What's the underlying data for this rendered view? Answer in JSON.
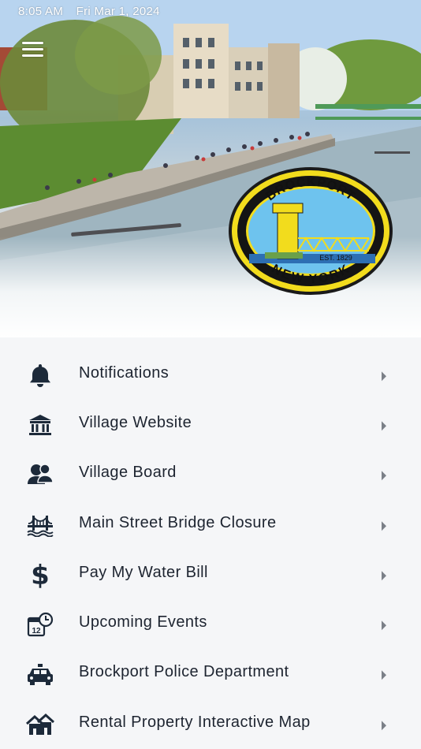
{
  "status_bar": {
    "time": "8:05 AM",
    "date": "Fri Mar 1, 2024"
  },
  "header": {
    "menu_icon": "hamburger-menu-icon"
  },
  "seal": {
    "top_text": "BROCKPORT",
    "bottom_text": "NEW YORK",
    "est": "EST. 1829"
  },
  "colors": {
    "icon": "#1d2a3a",
    "text": "#1d2430",
    "chevron": "#7b8088",
    "seal_yellow": "#f2dc1d",
    "seal_blue": "#6ec3ee"
  },
  "menu": {
    "items": [
      {
        "label": "Notifications",
        "icon": "bell-icon"
      },
      {
        "label": "Village Website",
        "icon": "building-icon"
      },
      {
        "label": "Village Board",
        "icon": "people-icon"
      },
      {
        "label": "Main Street Bridge Closure",
        "icon": "bridge-icon"
      },
      {
        "label": "Pay My Water Bill",
        "icon": "dollar-icon"
      },
      {
        "label": "Upcoming Events",
        "icon": "calendar-clock-icon"
      },
      {
        "label": "Brockport Police Department",
        "icon": "police-car-icon"
      },
      {
        "label": "Rental Property Interactive Map",
        "icon": "houses-icon"
      }
    ]
  }
}
